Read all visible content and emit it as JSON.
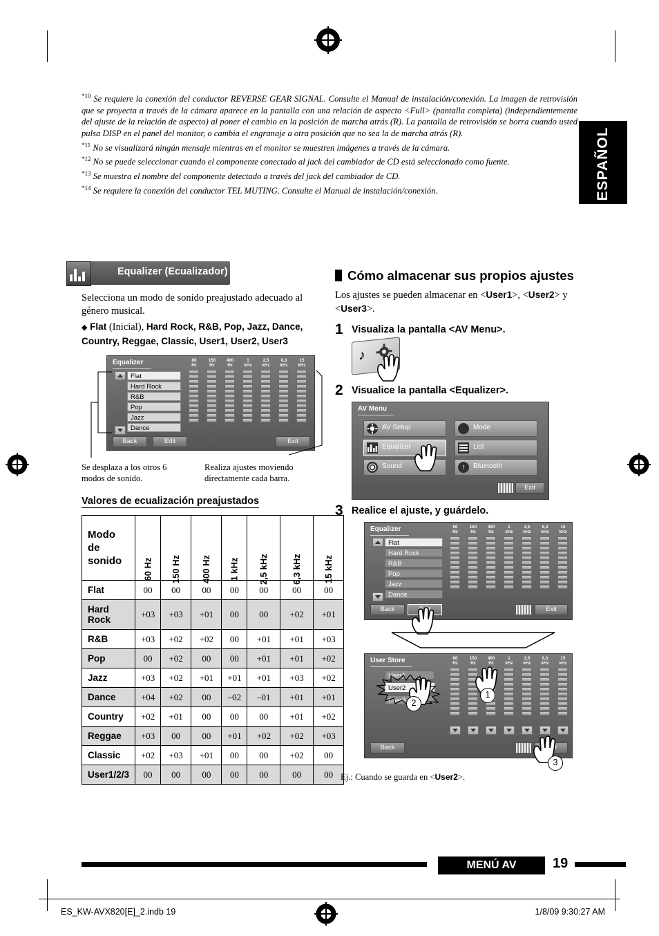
{
  "footnotes": [
    {
      "mark": "*10",
      "text": "Se requiere la conexión del conductor REVERSE GEAR SIGNAL. Consulte el Manual de instalación/conexión. La imagen de retrovisión que se proyecta a través de la cámara aparece en la pantalla con una relación de aspecto <Full> (pantalla completa) (independientemente del ajuste de la relación de aspecto) al poner el cambio en la posición de marcha atrás (R). La pantalla de retrovisión se borra cuando usted pulsa DISP en el panel del monitor, o cambia el engranaje a otra posición que no sea la de marcha atrás (R)."
    },
    {
      "mark": "*11",
      "text": "No se visualizará ningún mensaje mientras en el monitor se muestren imágenes a través de la cámara."
    },
    {
      "mark": "*12",
      "text": "No se puede seleccionar cuando el componente conectado al jack del cambiador de CD está seleccionado como fuente."
    },
    {
      "mark": "*13",
      "text": "Se muestra el nombre del componente detectado a través del jack del cambiador de CD."
    },
    {
      "mark": "*14",
      "text": "Se requiere la conexión del conductor TEL MUTING. Consulte el Manual de instalación/conexión."
    }
  ],
  "side_tab": "ESPAÑOL",
  "left": {
    "section_title": "Equalizer (Ecualizador)",
    "intro": "Selecciona un modo de sonido preajustado adecuado al género musical.",
    "bullet_prefix": "Flat",
    "bullet_initial": "(Inicial),",
    "bullet_rest": "Hard Rock, R&B, Pop, Jazz, Dance, Country, Reggae, Classic, User1, User2, User3",
    "screen": {
      "title": "Equalizer",
      "modes": [
        "Flat",
        "Hard Rock",
        "R&B",
        "Pop",
        "Jazz",
        "Dance"
      ],
      "freqs": [
        "60\nHz",
        "150\nHz",
        "400\nHz",
        "1\nkHz",
        "2,5\nkHz",
        "6,3\nkHz",
        "15\nkHz"
      ],
      "buttons": [
        "Back",
        "Edit",
        "Exit"
      ]
    },
    "caption_left": "Se desplaza a los otros 6 modos de sonido.",
    "caption_right": "Realiza ajustes moviendo directamente cada barra.",
    "table_title": "Valores de ecualización preajustados",
    "table": {
      "corner": "Modo de sonido",
      "columns": [
        "60 Hz",
        "150 Hz",
        "400 Hz",
        "1 kHz",
        "2,5 kHz",
        "6,3 kHz",
        "15 kHz"
      ],
      "rows": [
        {
          "name": "Flat",
          "values": [
            "00",
            "00",
            "00",
            "00",
            "00",
            "00",
            "00"
          ]
        },
        {
          "name": "Hard Rock",
          "values": [
            "+03",
            "+03",
            "+01",
            "00",
            "00",
            "+02",
            "+01"
          ]
        },
        {
          "name": "R&B",
          "values": [
            "+03",
            "+02",
            "+02",
            "00",
            "+01",
            "+01",
            "+03"
          ]
        },
        {
          "name": "Pop",
          "values": [
            "00",
            "+02",
            "00",
            "00",
            "+01",
            "+01",
            "+02"
          ]
        },
        {
          "name": "Jazz",
          "values": [
            "+03",
            "+02",
            "+01",
            "+01",
            "+01",
            "+03",
            "+02"
          ]
        },
        {
          "name": "Dance",
          "values": [
            "+04",
            "+02",
            "00",
            "–02",
            "–01",
            "+01",
            "+01"
          ]
        },
        {
          "name": "Country",
          "values": [
            "+02",
            "+01",
            "00",
            "00",
            "00",
            "+01",
            "+02"
          ]
        },
        {
          "name": "Reggae",
          "values": [
            "+03",
            "00",
            "00",
            "+01",
            "+02",
            "+02",
            "+03"
          ]
        },
        {
          "name": "Classic",
          "values": [
            "+02",
            "+03",
            "+01",
            "00",
            "00",
            "+02",
            "00"
          ]
        },
        {
          "name": "User1/2/3",
          "values": [
            "00",
            "00",
            "00",
            "00",
            "00",
            "00",
            "00"
          ]
        }
      ]
    }
  },
  "right": {
    "heading": "Cómo almacenar sus propios ajustes",
    "intro_1": "Los ajustes se pueden almacenar en <",
    "intro_user1": "User1",
    "intro_2": ">, <",
    "intro_user2": "User2",
    "intro_3": "> y <",
    "intro_user3": "User3",
    "intro_4": ">.",
    "steps": [
      {
        "num": "1",
        "text": "Visualiza la pantalla <AV Menu>."
      },
      {
        "num": "2",
        "text": "Visualice la pantalla <Equalizer>."
      },
      {
        "num": "3",
        "text": "Realice el ajuste, y guárdelo."
      }
    ],
    "avmenu": {
      "title": "AV Menu",
      "items": [
        "AV Setup",
        "Mode",
        "Equalizer",
        "List",
        "Sound",
        "Bluetooth"
      ],
      "exit": "Exit"
    },
    "eqscreen": {
      "title": "Equalizer",
      "modes": [
        "Flat",
        "Hard Rock",
        "R&B",
        "Pop",
        "Jazz",
        "Dance"
      ],
      "freqs": [
        "60\nHz",
        "150\nHz",
        "400\nHz",
        "1\nkHz",
        "2,5\nkHz",
        "6,3\nkHz",
        "15\nkHz"
      ],
      "buttons": [
        "Back",
        "Edit",
        "Exit"
      ]
    },
    "userstore": {
      "title": "User Store",
      "items": [
        "User1",
        "User2",
        "User3"
      ],
      "freqs": [
        "60\nHz",
        "150\nHz",
        "400\nHz",
        "1\nkHz",
        "2,5\nkHz",
        "6,3\nkHz",
        "15\nkHz"
      ],
      "buttons": [
        "Back",
        "Exit"
      ],
      "callouts": [
        "1",
        "2",
        "3"
      ]
    },
    "example_prefix": "Ej.: Cuando se guarda en <",
    "example_user": "User2",
    "example_suffix": ">."
  },
  "footer": {
    "menu_label": "MENÚ AV",
    "page_number": "19",
    "file": "ES_KW-AVX820[E]_2.indb   19",
    "stamp": "1/8/09   9:30:27 AM"
  }
}
